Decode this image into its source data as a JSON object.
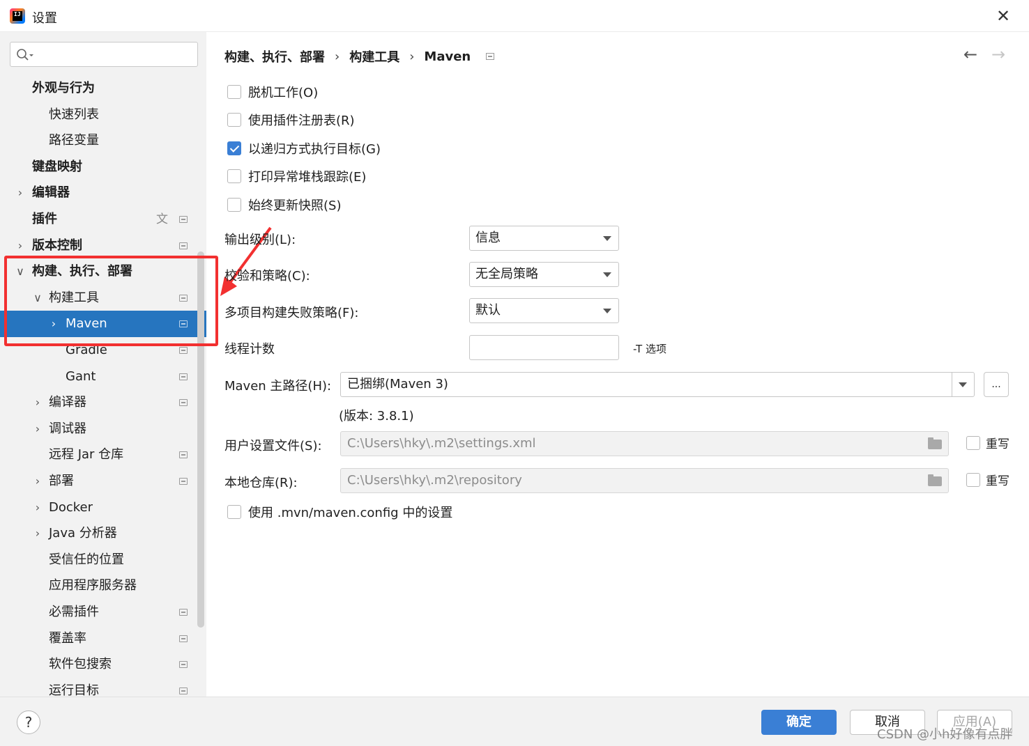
{
  "window": {
    "title": "设置",
    "icon": "intellij-idea-icon"
  },
  "search": {
    "placeholder": ""
  },
  "sidebar": {
    "items": [
      {
        "label": "外观与行为",
        "level": 0,
        "bold": true,
        "expand": "none",
        "project": false
      },
      {
        "label": "快速列表",
        "level": 1,
        "bold": false,
        "expand": "none",
        "project": false
      },
      {
        "label": "路径变量",
        "level": 1,
        "bold": false,
        "expand": "none",
        "project": false
      },
      {
        "label": "键盘映射",
        "level": 0,
        "bold": true,
        "expand": "none",
        "project": false
      },
      {
        "label": "编辑器",
        "level": 0,
        "bold": true,
        "expand": "collapsed",
        "project": false
      },
      {
        "label": "插件",
        "level": 0,
        "bold": true,
        "expand": "none",
        "project": true,
        "translate": true
      },
      {
        "label": "版本控制",
        "level": 0,
        "bold": true,
        "expand": "collapsed",
        "project": true
      },
      {
        "label": "构建、执行、部署",
        "level": 0,
        "bold": true,
        "expand": "expanded",
        "project": false
      },
      {
        "label": "构建工具",
        "level": 1,
        "bold": false,
        "expand": "expanded",
        "project": true
      },
      {
        "label": "Maven",
        "level": 2,
        "bold": false,
        "expand": "collapsed",
        "project": true,
        "selected": true
      },
      {
        "label": "Gradle",
        "level": 2,
        "bold": false,
        "expand": "none",
        "project": true
      },
      {
        "label": "Gant",
        "level": 2,
        "bold": false,
        "expand": "none",
        "project": true
      },
      {
        "label": "编译器",
        "level": 1,
        "bold": false,
        "expand": "collapsed",
        "project": true
      },
      {
        "label": "调试器",
        "level": 1,
        "bold": false,
        "expand": "collapsed",
        "project": false
      },
      {
        "label": "远程 Jar 仓库",
        "level": 1,
        "bold": false,
        "expand": "none",
        "project": true
      },
      {
        "label": "部署",
        "level": 1,
        "bold": false,
        "expand": "collapsed",
        "project": true
      },
      {
        "label": "Docker",
        "level": 1,
        "bold": false,
        "expand": "collapsed",
        "project": false
      },
      {
        "label": "Java 分析器",
        "level": 1,
        "bold": false,
        "expand": "collapsed",
        "project": false
      },
      {
        "label": "受信任的位置",
        "level": 1,
        "bold": false,
        "expand": "none",
        "project": false
      },
      {
        "label": "应用程序服务器",
        "level": 1,
        "bold": false,
        "expand": "none",
        "project": false
      },
      {
        "label": "必需插件",
        "level": 1,
        "bold": false,
        "expand": "none",
        "project": true
      },
      {
        "label": "覆盖率",
        "level": 1,
        "bold": false,
        "expand": "none",
        "project": true
      },
      {
        "label": "软件包搜索",
        "level": 1,
        "bold": false,
        "expand": "none",
        "project": true
      },
      {
        "label": "运行目标",
        "level": 1,
        "bold": false,
        "expand": "none",
        "project": true
      }
    ]
  },
  "breadcrumb": {
    "items": [
      "构建、执行、部署",
      "构建工具",
      "Maven"
    ],
    "separator": "›"
  },
  "nav": {
    "back": "←",
    "forward": "→"
  },
  "checkboxes": [
    {
      "label": "脱机工作(O)",
      "checked": false
    },
    {
      "label": "使用插件注册表(R)",
      "checked": false
    },
    {
      "label": "以递归方式执行目标(G)",
      "checked": true
    },
    {
      "label": "打印异常堆栈跟踪(E)",
      "checked": false
    },
    {
      "label": "始终更新快照(S)",
      "checked": false
    }
  ],
  "form": {
    "output_level": {
      "label": "输出级别(L):",
      "value": "信息"
    },
    "checksum_policy": {
      "label": "校验和策略(C):",
      "value": "无全局策略"
    },
    "multiproject_policy": {
      "label": "多项目构建失败策略(F):",
      "value": "默认"
    },
    "thread_count": {
      "label": "线程计数",
      "value": "",
      "hint": "-T 选项"
    },
    "maven_home": {
      "label": "Maven 主路径(H):",
      "value": "已捆绑(Maven 3)",
      "browse": "...",
      "version": "(版本: 3.8.1)"
    },
    "user_settings": {
      "label": "用户设置文件(S):",
      "value": "C:\\Users\\hky\\.m2\\settings.xml",
      "override": "重写",
      "override_checked": false
    },
    "local_repo": {
      "label": "本地仓库(R):",
      "value": "C:\\Users\\hky\\.m2\\repository",
      "override": "重写",
      "override_checked": false
    },
    "use_mvn_config": {
      "label": "使用 .mvn/maven.config 中的设置",
      "checked": false
    }
  },
  "footer": {
    "help": "?",
    "ok": "确定",
    "cancel": "取消",
    "apply": "应用(A)"
  },
  "watermark": "CSDN @小h好像有点胖",
  "colors": {
    "accent": "#3a7fd5",
    "selection": "#2675bf",
    "annotation": "#f23030",
    "sidebar_bg": "#f2f2f2"
  }
}
